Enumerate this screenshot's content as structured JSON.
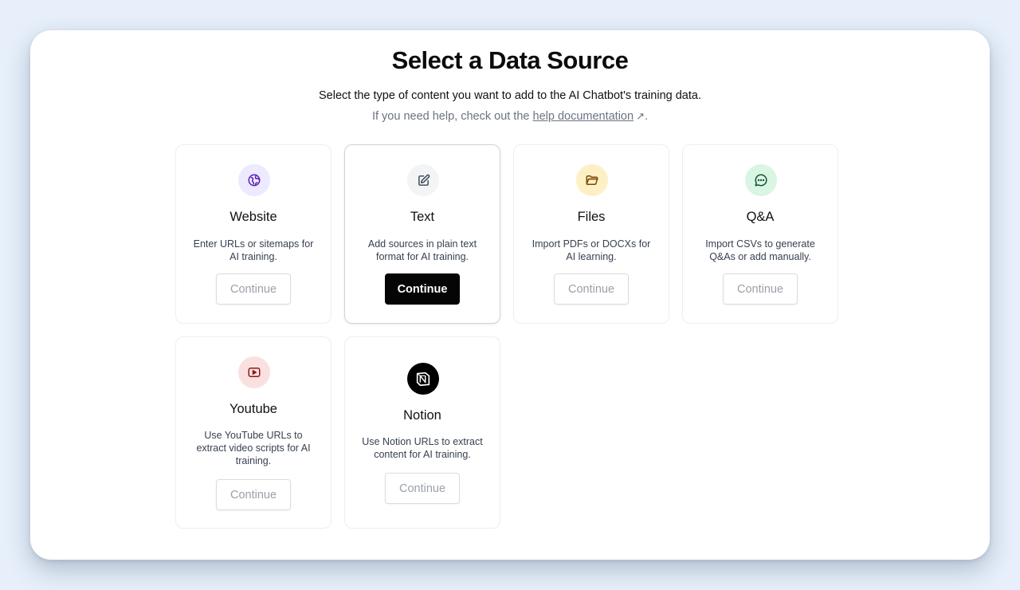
{
  "header": {
    "title": "Select a Data Source",
    "subtitle": "Select the type of content you want to add to the AI Chatbot's training data.",
    "help_prefix": "If you need help, check out the",
    "help_link": "help documentation",
    "help_arrow": "↗",
    "help_suffix": "."
  },
  "cards": [
    {
      "title": "Website",
      "desc": "Enter URLs or sitemaps for AI training.",
      "button": "Continue",
      "icon": "globe-icon",
      "icon_bg": "#ede9fe",
      "icon_color": "#5b21b6"
    },
    {
      "title": "Text",
      "desc": "Add sources in plain text format for AI training.",
      "button": "Continue",
      "icon": "edit-icon",
      "icon_bg": "#f3f4f6",
      "icon_color": "#374151",
      "selected": true
    },
    {
      "title": "Files",
      "desc": "Import PDFs or DOCXs for AI learning.",
      "button": "Continue",
      "icon": "folder-icon",
      "icon_bg": "#fdf0c4",
      "icon_color": "#7c4a03"
    },
    {
      "title": "Q&A",
      "desc": "Import CSVs to generate Q&As or add manually.",
      "button": "Continue",
      "icon": "chat-icon",
      "icon_bg": "#d9f5e3",
      "icon_color": "#14532d"
    },
    {
      "title": "Youtube",
      "desc": "Use YouTube URLs to extract video scripts for AI training.",
      "button": "Continue",
      "icon": "youtube-icon",
      "icon_bg": "#fbe0e0",
      "icon_color": "#8b1a1a"
    },
    {
      "title": "Notion",
      "desc": "Use Notion URLs to extract content for AI training.",
      "button": "Continue",
      "icon": "notion-icon",
      "icon_bg": "#000000",
      "icon_color": "#ffffff"
    }
  ]
}
